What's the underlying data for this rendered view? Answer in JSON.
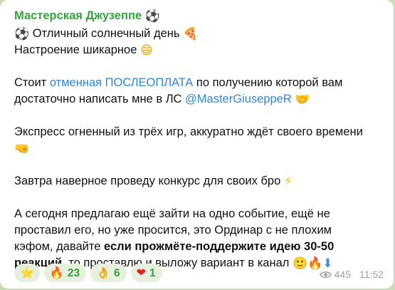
{
  "channel": {
    "name": "Мастерская Джузеппе",
    "name_emoji": "⚽"
  },
  "message": {
    "line1": {
      "emoji": "⚽",
      "text": " Отличный солнечный день ",
      "emoji_end": "🍕"
    },
    "line2": {
      "text": "Настроение шикарное ",
      "emoji_end": "😄"
    },
    "para2": {
      "part1": "Стоит ",
      "link": "отменная ПОСЛЕОПЛАТА",
      "part2": " по получению которой вам",
      "line2": "достаточно написать мне в ЛС ",
      "mention": "@MasterGiuseppeR",
      "emoji_end": "🤝"
    },
    "para3": {
      "text": "Экспресс огненный из трёх игр, аккуратно ждёт своего времени",
      "emoji": "🤜"
    },
    "para4": {
      "text": "Завтра наверное проведу конкурс для своих бро ",
      "emoji_end": "⚡"
    },
    "para5": {
      "line1": "А сегодня предлагаю ещё зайти на одно событие, ещё не",
      "line2": "проставил его, но уже просится, это Ординар с не плохим",
      "line3_plain": "кэфом, давайте ",
      "line3_bold": "если прожмёте-поддержите идею 30-50",
      "line4_bold": "реакций,",
      "line4_plain": " то проставлю и выложу вариант в канал ",
      "emojis_end": [
        "🙂",
        "🔥",
        "⬇"
      ]
    }
  },
  "reactions": [
    {
      "emoji": "⭐",
      "count": ""
    },
    {
      "emoji": "🔥",
      "count": "23"
    },
    {
      "emoji": "👌",
      "count": "6"
    },
    {
      "emoji": "❤",
      "count": "1"
    }
  ],
  "meta": {
    "views": "445",
    "time": "11:52",
    "views_icon": "eye-icon"
  }
}
